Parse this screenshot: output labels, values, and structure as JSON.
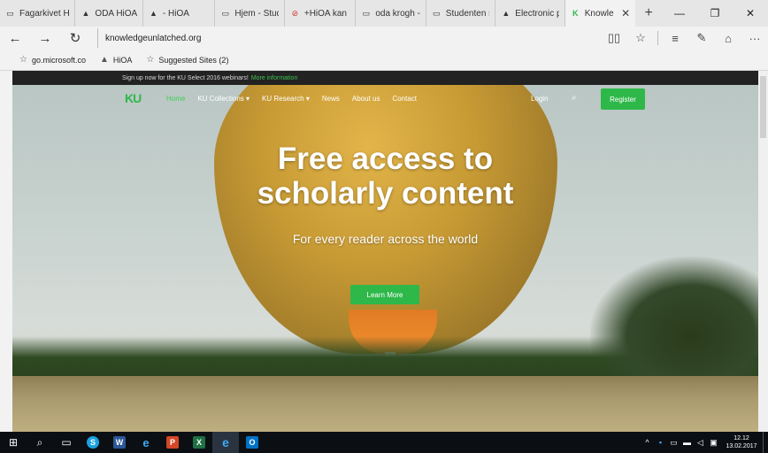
{
  "browser": {
    "tabs": [
      {
        "icon": "page-icon",
        "label": "Fagarkivet Hi"
      },
      {
        "icon": "hioa-icon",
        "label": "ODA HiOA - I"
      },
      {
        "icon": "hioa-icon",
        "label": "- HiOA"
      },
      {
        "icon": "page-icon",
        "label": "Hjem - Stude"
      },
      {
        "icon": "stop-icon",
        "label": "+HiOA kan ku"
      },
      {
        "icon": "page-icon",
        "label": "oda krogh - E"
      },
      {
        "icon": "page-icon",
        "label": "Studenten so"
      },
      {
        "icon": "hioa-icon",
        "label": "Electronic pul"
      },
      {
        "icon": "ku-icon",
        "label": "Knowledg",
        "active": true
      }
    ],
    "address": "knowledgeunlatched.org",
    "favorites": [
      {
        "icon": "star-add-icon",
        "label": "go.microsoft.co"
      },
      {
        "icon": "hioa-icon",
        "label": "HiOA"
      },
      {
        "icon": "star-icon",
        "label": "Suggested Sites (2)"
      }
    ]
  },
  "site": {
    "promo_text": "Sign up now for the KU Select 2016 webinars!",
    "promo_link": "More information",
    "logo": "KU",
    "menu": {
      "home": "Home",
      "collections": "KU Collections ▾",
      "research": "KU Research ▾",
      "news": "News",
      "about": "About us",
      "contact": "Contact"
    },
    "login": "Login",
    "register": "Register",
    "hero_title_line1": "Free access to",
    "hero_title_line2": "scholarly content",
    "hero_subtitle": "For every reader across the world",
    "cta": "Learn More"
  },
  "taskbar": {
    "time": "12.12",
    "date": "13.02.2017"
  },
  "colors": {
    "accent": "#2eb84a",
    "taskbar": "#0b0f14"
  }
}
